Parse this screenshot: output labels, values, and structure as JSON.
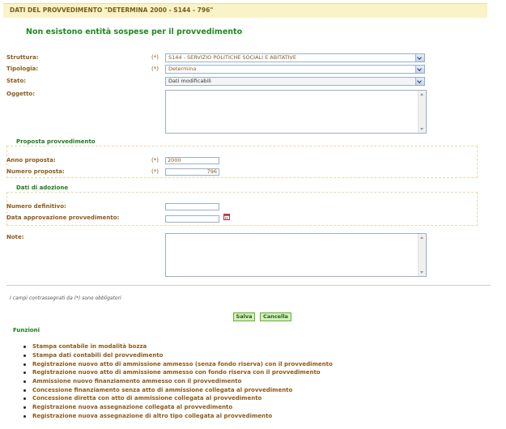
{
  "header": {
    "title": "DATI DEL PROVVEDIMENTO \"DETERMINA 2000 - S144 - 796\""
  },
  "message": "Non esistono entità sospese per il provvedimento",
  "form": {
    "required_mark": "(*)",
    "struttura": {
      "label": "Struttura:",
      "value": "S144 - SERVIZIO POLITICHE SOCIALI E ABITATIVE"
    },
    "tipologia": {
      "label": "Tipologia:",
      "value": "Determina"
    },
    "stato": {
      "label": "Stato:",
      "value": "Dati modificabili"
    },
    "oggetto": {
      "label": "Oggetto:",
      "value": ""
    },
    "proposta": {
      "title": "Proposta provvedimento",
      "anno_label": "Anno proposta:",
      "anno_value": "2000",
      "numero_label": "Numero proposta:",
      "numero_value": "796"
    },
    "adozione": {
      "title": "Dati di adozione",
      "numero_label": "Numero definitivo:",
      "numero_value": "",
      "data_label": "Data approvazione provvedimento:",
      "data_value": ""
    },
    "note": {
      "label": "Note:",
      "value": ""
    }
  },
  "footnote": "I campi contrassegnati da (*) sono obbligatori",
  "buttons": {
    "save": "Salva",
    "cancel": "Cancella"
  },
  "functions": {
    "title": "Funzioni",
    "items": [
      "Stampa contabile in modalità bozza",
      "Stampa dati contabili del provvedimento",
      "Registrazione nuovo atto di ammissione ammesso (senza fondo riserva) con il provvedimento",
      "Registrazione nuovo atto di ammissione ammesso con fondo riserva con il provvedimento",
      "Ammissione nuovo finanziamento ammesso con il provvedimento",
      "Concessione finanziamento senza atto di ammissione collegata al provvedimento",
      "Concessione diretta con atto di ammissione collegata al provvedimento",
      "Registrazione nuova assegnazione collegata al provvedimento",
      "Registrazione nuova assegnazione di altro tipo collegata al provvedimento"
    ]
  }
}
